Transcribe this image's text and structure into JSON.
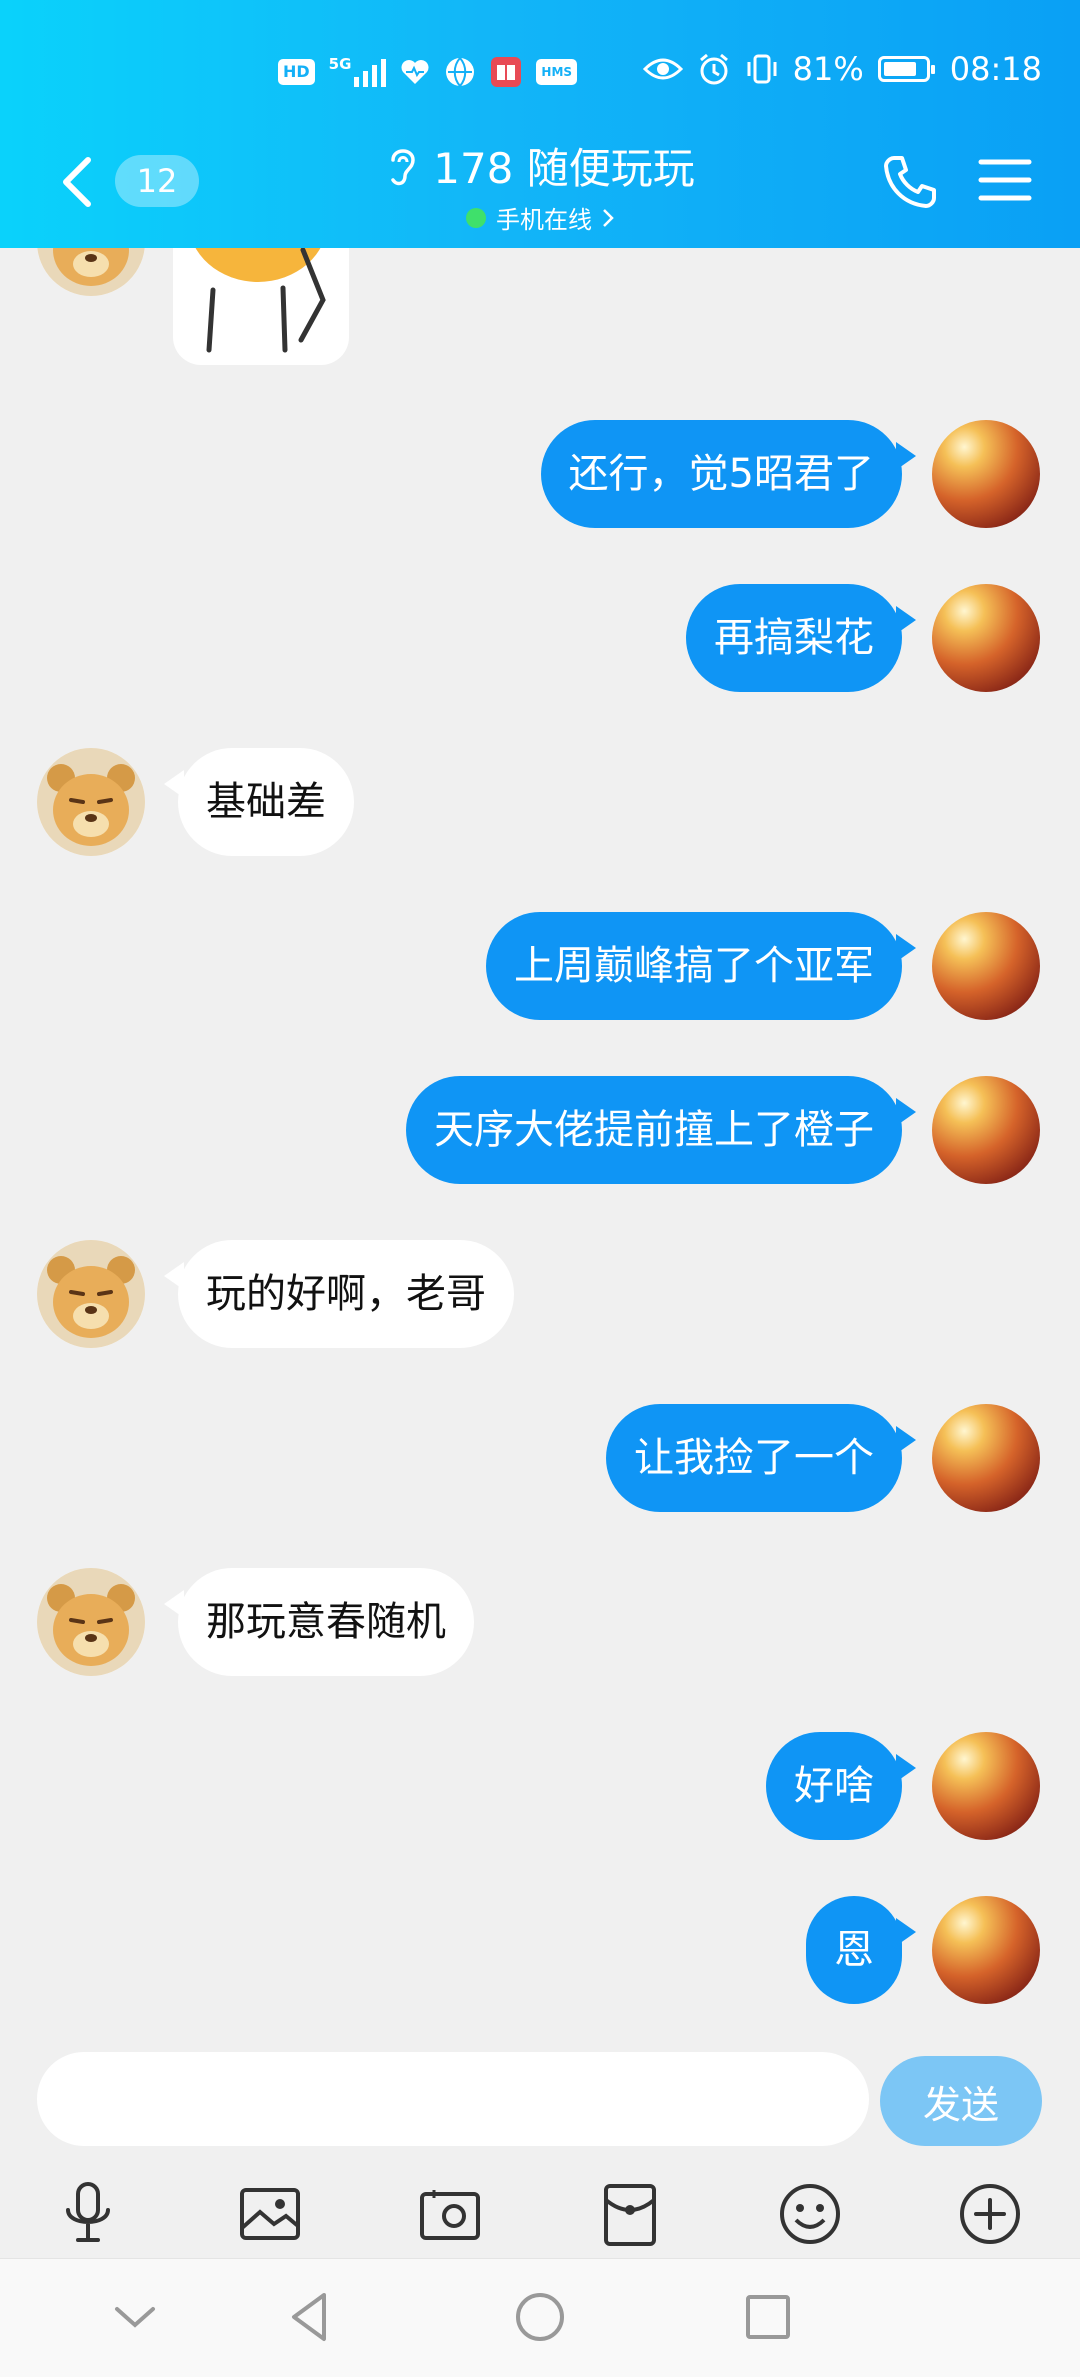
{
  "status_bar": {
    "chip_hd": "HD",
    "net_5g": "5G",
    "chip_hms": "HMS",
    "battery_percent": "81%",
    "battery_level": 0.81,
    "time": "08:18"
  },
  "header": {
    "unread_count": "12",
    "title": "178 随便玩玩",
    "subtitle": "手机在线",
    "colors": {
      "gradient_start": "#0ad2fb",
      "gradient_end": "#0aa0f5",
      "online": "#3fe06b"
    }
  },
  "messages": [
    {
      "from": "me",
      "text": "还行，觉5昭君了"
    },
    {
      "from": "me",
      "text": "再搞梨花"
    },
    {
      "from": "them",
      "text": "基础差"
    },
    {
      "from": "me",
      "text": "上周巅峰搞了个亚军"
    },
    {
      "from": "me",
      "text": "天序大佬提前撞上了橙子"
    },
    {
      "from": "them",
      "text": "玩的好啊，老哥"
    },
    {
      "from": "me",
      "text": "让我捡了一个"
    },
    {
      "from": "them",
      "text": "那玩意春随机"
    },
    {
      "from": "me",
      "text": "好啥"
    },
    {
      "from": "me",
      "text": "恩"
    }
  ],
  "input": {
    "value": "",
    "send_label": "发送"
  },
  "toolbar": [
    "microphone-icon",
    "image-icon",
    "camera-icon",
    "red-packet-icon",
    "emoji-icon",
    "plus-icon"
  ],
  "navbar": [
    "hide-icon",
    "back-icon",
    "home-icon",
    "recents-icon"
  ],
  "colors": {
    "my_bubble": "#0f95f5",
    "their_bubble": "#ffffff",
    "background": "#f0f0f0",
    "send_button": "#7cc6f5"
  }
}
